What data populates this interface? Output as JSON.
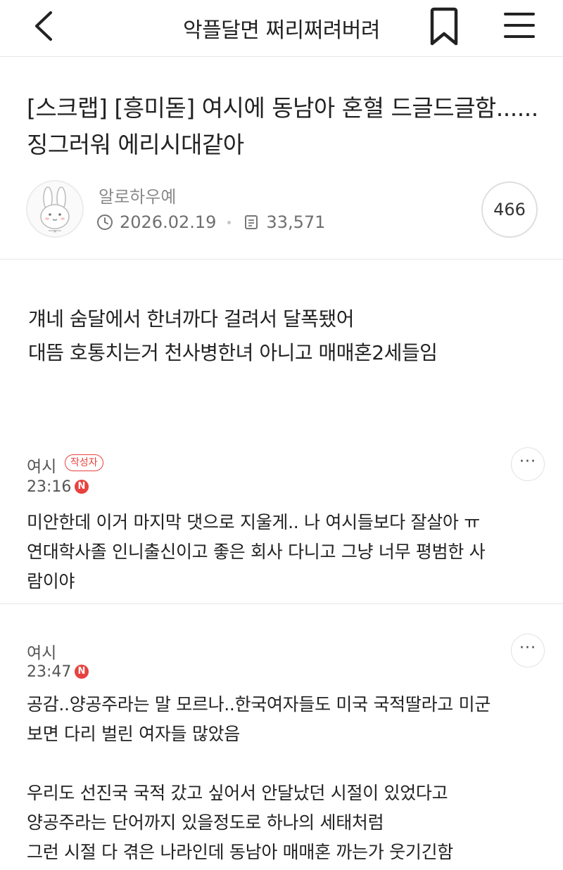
{
  "header": {
    "title": "악플달면 쩌리쩌려버려"
  },
  "post": {
    "title": "[스크랩] [흥미돋] 여시에 동남아 혼혈 드글드글함...... 징그러워 에리시대같아",
    "author": "알로하우예",
    "date": "2026.02.19",
    "views": "33,571",
    "comment_count": "466",
    "body": [
      "걔네 숨달에서 한녀까다 걸려서 달폭됐어",
      "대뜸 호통치는거 천사병한녀 아니고 매매혼2세들임"
    ]
  },
  "comments": [
    {
      "author": "여시",
      "badge": "작성자",
      "time": "23:16",
      "new_badge": "N",
      "more": "···",
      "lines": [
        "미안한데 이거 마지막 댓으로 지울게.. 나 여시들보다 잘살아 ㅠ",
        "연대학사졸 인니출신이고 좋은 회사 다니고 그냥 너무 평범한 사",
        "람이야"
      ]
    },
    {
      "author": "여시",
      "time": "23:47",
      "new_badge": "N",
      "more": "···",
      "lines": [
        "공감..양공주라는 말 모르나..한국여자들도 미국 국적딸라고 미군",
        "보면 다리 벌린 여자들 많았음",
        "",
        "우리도 선진국 국적 갔고 싶어서 안달났던 시절이 있었다고",
        "양공주라는 단어까지 있을정도로 하나의 세태처럼",
        "그런 시절 다 겪은 나라인데 동남아 매매혼 까는가 웃기긴함"
      ]
    }
  ],
  "colors": {
    "accent": "#e8423f",
    "text": "#222222",
    "muted": "#8a8a8a",
    "divider": "#e6e6e6"
  },
  "icons": {
    "back": "chevron-left-icon",
    "bookmark": "bookmark-icon",
    "menu": "hamburger-menu-icon",
    "clock": "clock-icon",
    "views": "document-icon",
    "more": "more-dots-icon"
  }
}
